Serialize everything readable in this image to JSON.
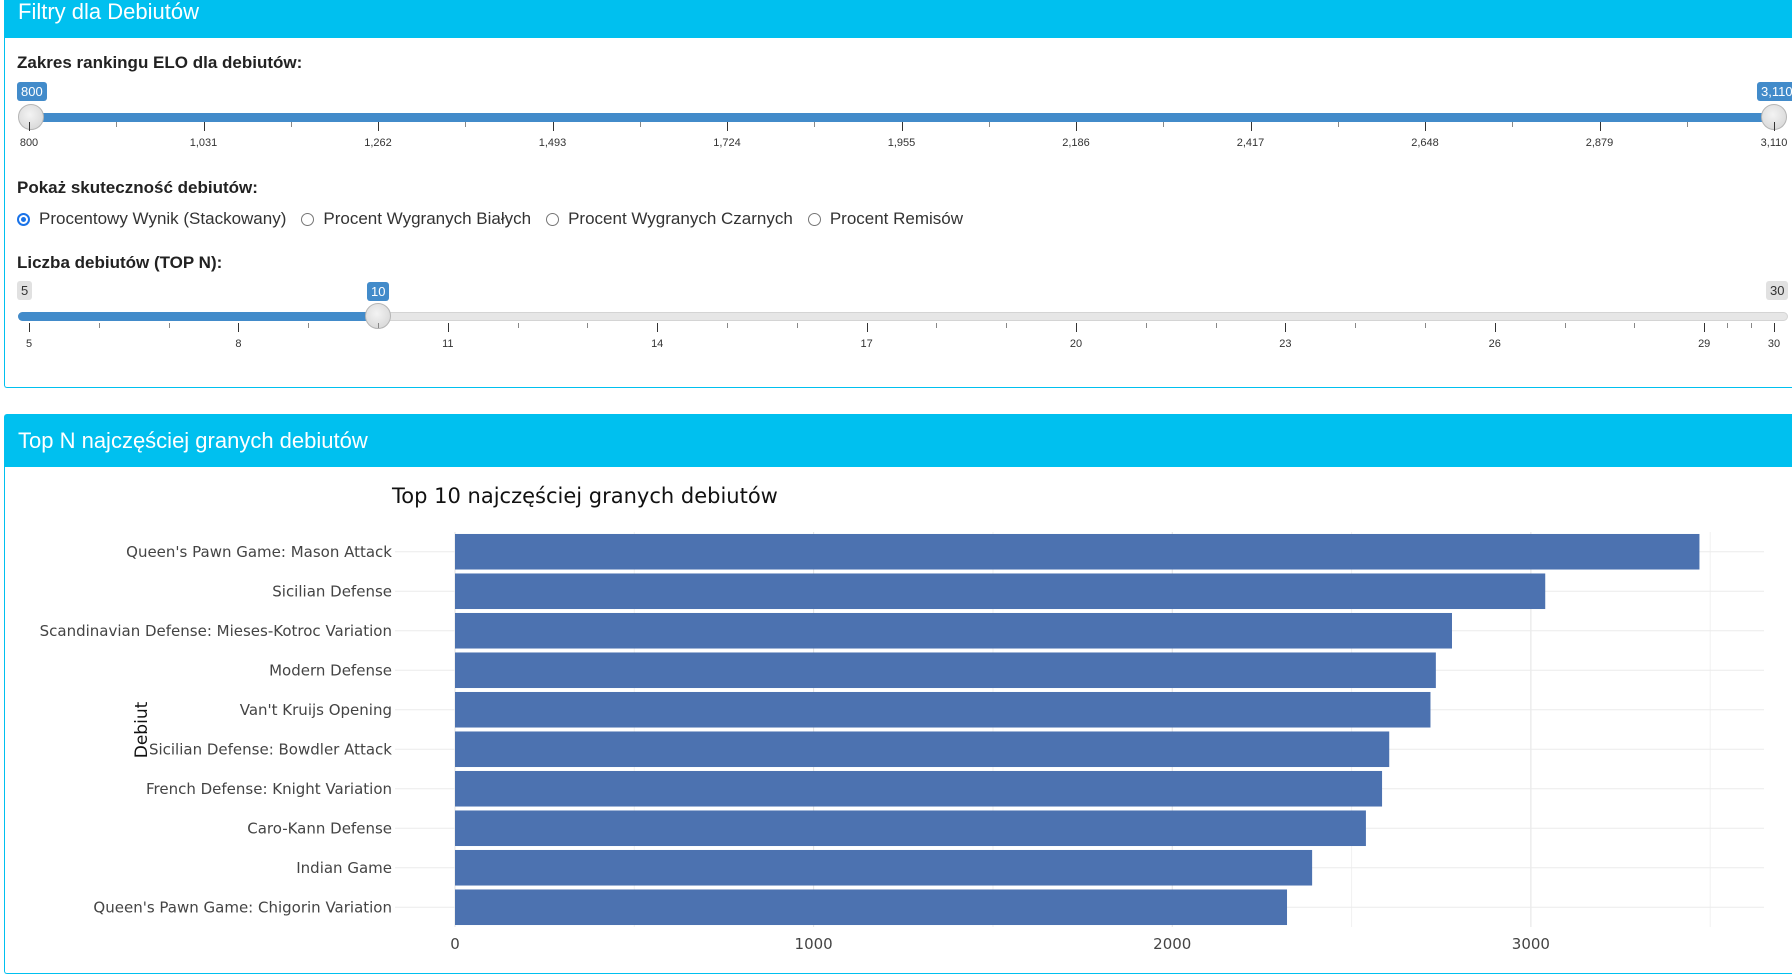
{
  "filters": {
    "header": "Filtry dla Debiutów",
    "elo_label": "Zakres rankingu ELO dla debiutów:",
    "elo_min_value": "800",
    "elo_max_value": "3,110",
    "elo_range": [
      800,
      3110
    ],
    "elo_selected": [
      800,
      3110
    ],
    "elo_ticks": [
      "800",
      "1,031",
      "1,262",
      "1,493",
      "1,724",
      "1,955",
      "2,186",
      "2,417",
      "2,648",
      "2,879",
      "3,110"
    ],
    "success_label": "Pokaż skuteczność debiutów:",
    "radio_options": [
      {
        "label": "Procentowy Wynik (Stackowany)",
        "selected": true
      },
      {
        "label": "Procent Wygranych Białych",
        "selected": false
      },
      {
        "label": "Procent Wygranych Czarnych",
        "selected": false
      },
      {
        "label": "Procent Remisów",
        "selected": false
      }
    ],
    "topn_label": "Liczba debiutów (TOP N):",
    "topn_min": "5",
    "topn_max": "30",
    "topn_value": "10",
    "topn_range": [
      5,
      30
    ],
    "topn_selected": 10,
    "topn_ticks": [
      "5",
      "8",
      "11",
      "14",
      "17",
      "20",
      "23",
      "26",
      "29",
      "30"
    ]
  },
  "panel2": {
    "header": "Top N najczęściej granych debiutów"
  },
  "colors": {
    "header_bg": "#00c0ef",
    "slider_accent": "#428bca",
    "bar": "#4c72b0"
  },
  "chart_data": {
    "type": "bar",
    "orientation": "horizontal",
    "title": "Top 10 najczęściej granych debiutów",
    "ylabel": "Debiut",
    "xlabel": "",
    "categories": [
      "Queen's Pawn Game: Mason Attack",
      "Sicilian Defense",
      "Scandinavian Defense: Mieses-Kotroc Variation",
      "Modern Defense",
      "Van't Kruijs Opening",
      "Sicilian Defense: Bowdler Attack",
      "French Defense: Knight Variation",
      "Caro-Kann Defense",
      "Indian Game",
      "Queen's Pawn Game: Chigorin Variation"
    ],
    "values": [
      3470,
      3040,
      2780,
      2735,
      2720,
      2605,
      2585,
      2540,
      2390,
      2320
    ],
    "xticks": [
      0,
      1000,
      2000,
      3000
    ],
    "xlim": [
      0,
      3650
    ],
    "grid": true
  }
}
